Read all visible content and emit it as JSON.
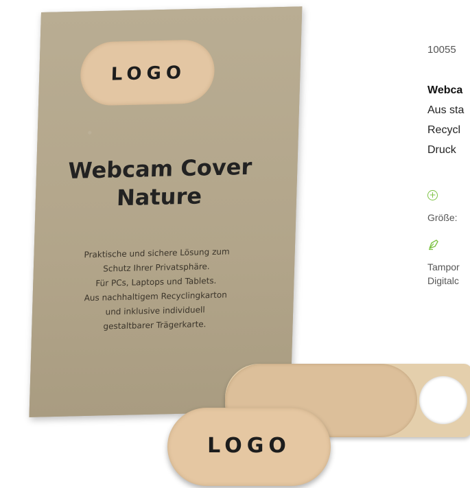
{
  "product_image": {
    "card": {
      "logo_label": "LOGO",
      "title_line1": "Webcam Cover",
      "title_line2": "Nature",
      "description": [
        "Praktische und sichere Lösung zum",
        "Schutz Ihrer Privatsphäre.",
        "Für PCs, Laptops und Tablets.",
        "Aus nachhaltigem Recyclingkarton",
        "und inklusive individuell",
        "gestaltbarer Trägerkarte."
      ]
    },
    "front_cover_logo": "LOGO"
  },
  "info": {
    "article_number": "10055",
    "title": "Webca",
    "description_lines": [
      "Aus sta",
      "Recycl",
      "Druck"
    ],
    "size_label": "Größe:",
    "print_methods": [
      "Tampor",
      "Digitalc"
    ]
  },
  "colors": {
    "accent": "#7cc242",
    "card": "#b5a88e",
    "cover": "#e5c7a2"
  },
  "icons": {
    "size": "plus-circle-icon",
    "print": "pen-nib-icon"
  }
}
